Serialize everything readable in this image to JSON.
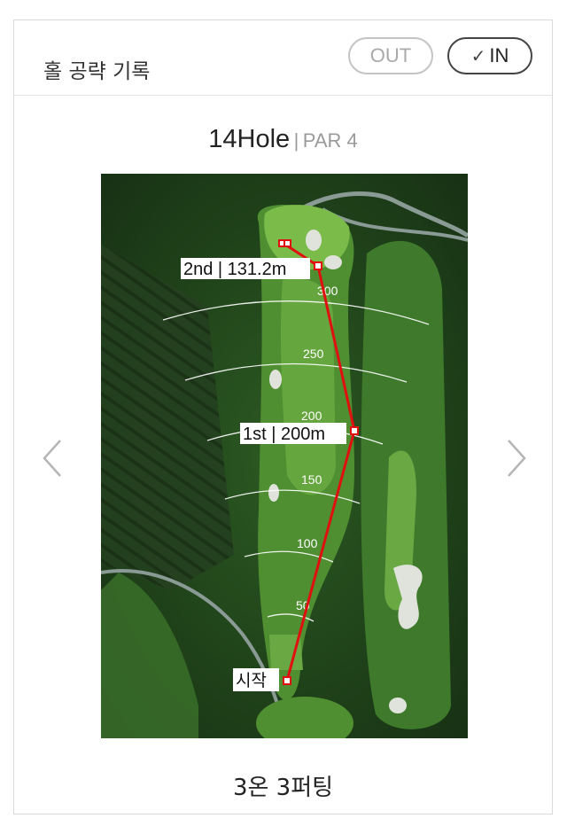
{
  "header": {
    "title": "홀 공략 기록",
    "tabs": [
      {
        "label": "OUT",
        "selected": false
      },
      {
        "label": "IN",
        "selected": true
      }
    ]
  },
  "hole": {
    "number_label": "14Hole",
    "separator": "|",
    "par_label": "PAR 4"
  },
  "map": {
    "distance_labels": [
      "300",
      "250",
      "200",
      "150",
      "100",
      "50"
    ],
    "shots": [
      {
        "label": "2nd | 131.2m"
      },
      {
        "label": "1st | 200m"
      },
      {
        "label": "시작"
      }
    ],
    "line_color": "#e01010"
  },
  "nav": {
    "prev_icon": "chevron-left-icon",
    "next_icon": "chevron-right-icon"
  },
  "summary": "3온 3퍼팅"
}
